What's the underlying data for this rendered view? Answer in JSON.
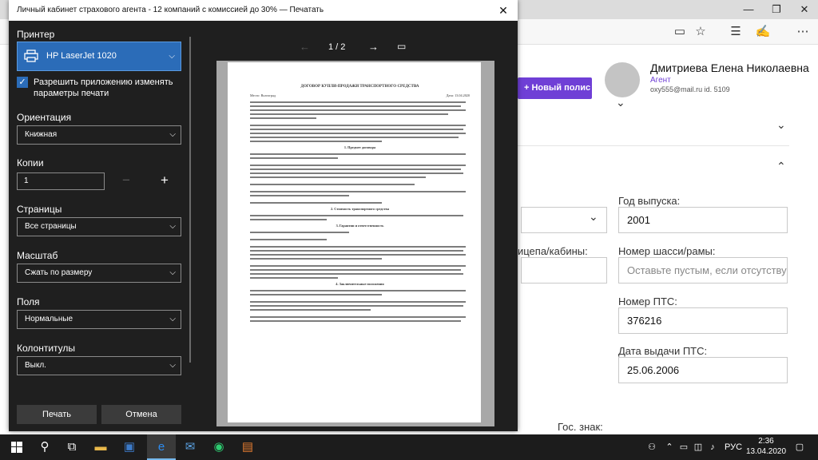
{
  "browser": {
    "window_minimize": "—",
    "window_restore": "❐",
    "window_close": "✕",
    "toolbar_icons": [
      "▭",
      "☆",
      "☰",
      "✍",
      "⋯"
    ]
  },
  "app": {
    "new_policy_label": "+ Новый полис",
    "user_name": "Дмитриева Елена Николаевна",
    "user_role": "Агент",
    "user_contact": "oxy555@mail.ru   id. 5109",
    "fields": {
      "year_label": "Год выпуска:",
      "year_value": "2001",
      "chassis_label": "Номер шасси/рамы:",
      "chassis_placeholder": "Оставьте пустым, если отсутствует",
      "cabin_label": "ицепа/кабины:",
      "pts_number_label": "Номер ПТС:",
      "pts_number_value": "376216",
      "pts_date_label": "Дата выдачи ПТС:",
      "pts_date_value": "25.06.2006",
      "gos_znak_label": "Гос. знак:"
    }
  },
  "dialog": {
    "title": "Личный кабинет страхового агента - 12 компаний с комиссией до 30% — Печатать",
    "close": "✕",
    "printer_label": "Принтер",
    "printer_value": "HP LaserJet 1020",
    "allow_label": "Разрешить приложению изменять параметры печати",
    "allow_checked": true,
    "orientation_label": "Ориентация",
    "orientation_value": "Книжная",
    "copies_label": "Копии",
    "copies_value": "1",
    "pages_label": "Страницы",
    "pages_value": "Все страницы",
    "scale_label": "Масштаб",
    "scale_value": "Сжать по размеру",
    "margins_label": "Поля",
    "margins_value": "Нормальные",
    "headers_label": "Колонтитулы",
    "headers_value": "Выкл.",
    "print_button": "Печать",
    "cancel_button": "Отмена",
    "page_indicator": "1 / 2"
  },
  "document": {
    "title": "ДОГОВОР КУПЛИ-ПРОДАЖИ ТРАНСПОРТНОГО СРЕДСТВА",
    "city": "Место: Волгоград",
    "date": "Дата: 13.04.2020",
    "sections": [
      "1. Предмет договора",
      "2. Стоимость транспортного средства",
      "3. Гарантии и ответственность",
      "4. Заключительные положения"
    ]
  },
  "taskbar": {
    "lang": "РУС",
    "time": "2:36",
    "date": "13.04.2020"
  }
}
